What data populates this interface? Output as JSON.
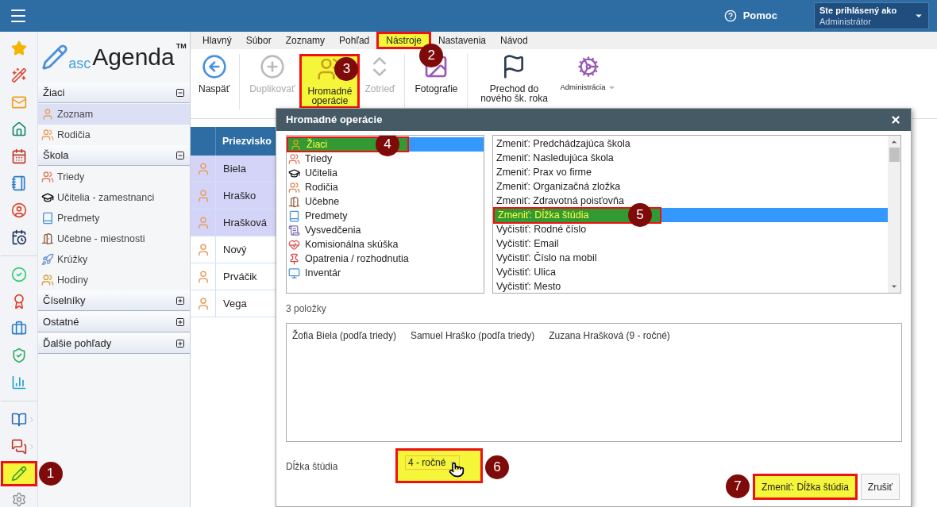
{
  "topbar": {
    "help": "Pomoc",
    "login_caption": "Ste prihlásený ako",
    "login_user": "Administrátor"
  },
  "rail": [
    {
      "selected": false,
      "submenu": false
    },
    {
      "selected": false,
      "submenu": false
    },
    {
      "selected": false,
      "submenu": false
    },
    {
      "selected": false,
      "submenu": false
    },
    {
      "selected": false,
      "submenu": false
    },
    {
      "selected": false,
      "submenu": false
    },
    {
      "selected": false,
      "submenu": false
    },
    {
      "selected": false,
      "submenu": false
    },
    {
      "selected": false,
      "submenu": false
    },
    {
      "selected": false,
      "submenu": false
    },
    {
      "selected": false,
      "submenu": false
    },
    {
      "selected": false,
      "submenu": false
    },
    {
      "selected": false,
      "submenu": false
    },
    {
      "selected": false,
      "submenu": true
    },
    {
      "selected": false,
      "submenu": true
    },
    {
      "selected": true,
      "submenu": false,
      "callout": "1"
    }
  ],
  "logo": {
    "prefix": "asc",
    "name": "Agenda",
    "tm": "TM"
  },
  "sidebar": [
    {
      "title": "Žiaci",
      "expanded": true,
      "items": [
        {
          "label": "Zoznam",
          "selected": true
        },
        {
          "label": "Rodičia",
          "selected": false
        }
      ]
    },
    {
      "title": "Škola",
      "expanded": true,
      "items": [
        {
          "label": "Triedy",
          "selected": false
        },
        {
          "label": "Učitelia - zamestnanci",
          "selected": false
        },
        {
          "label": "Predmety",
          "selected": false
        },
        {
          "label": "Učebne - miestnosti",
          "selected": false
        },
        {
          "label": "Krúžky",
          "selected": false
        },
        {
          "label": "Hodiny",
          "selected": false
        }
      ]
    },
    {
      "title": "Číselníky",
      "expanded": false
    },
    {
      "title": "Ostatné",
      "expanded": false
    },
    {
      "title": "Ďalšie pohľady",
      "expanded": false
    }
  ],
  "tabs": [
    {
      "label": "Hlavný",
      "selected": false
    },
    {
      "label": "Súbor",
      "selected": false
    },
    {
      "label": "Zoznamy",
      "selected": false
    },
    {
      "label": "Pohľad",
      "selected": false
    },
    {
      "label": "Nástroje",
      "selected": true,
      "callout": "2"
    },
    {
      "label": "Nastavenia",
      "selected": false
    },
    {
      "label": "Návod",
      "selected": false
    }
  ],
  "ribbon": [
    {
      "kind": "large",
      "label": "Naspäť",
      "disabled": false
    },
    {
      "kind": "large",
      "label": "Duplikovať",
      "disabled": true
    },
    {
      "kind": "large",
      "label": "Hromadné operácie",
      "disabled": false,
      "callout": "3"
    },
    {
      "kind": "large",
      "label": "Zotrieď",
      "disabled": true
    },
    {
      "kind": "large",
      "label": "Fotografie",
      "disabled": false
    },
    {
      "kind": "large",
      "label": "Prechod do nového šk. roka",
      "disabled": false
    },
    {
      "kind": "dropdown",
      "label": "Administrácia",
      "disabled": false
    }
  ],
  "table": {
    "columns": [
      "Priezvisko"
    ],
    "rows": [
      {
        "name": "Biela",
        "selected": true
      },
      {
        "name": "Hraško",
        "selected": true
      },
      {
        "name": "Hrašková",
        "selected": true
      },
      {
        "name": "Nový",
        "selected": false
      },
      {
        "name": "Prváčik",
        "selected": false
      },
      {
        "name": "Vega",
        "selected": false
      }
    ]
  },
  "dialog": {
    "title": "Hromadné operácie",
    "categories": [
      {
        "label": "Žiaci",
        "selected": true,
        "callout": "4"
      },
      {
        "label": "Triedy",
        "selected": false
      },
      {
        "label": "Učitelia",
        "selected": false
      },
      {
        "label": "Rodičia",
        "selected": false
      },
      {
        "label": "Učebne",
        "selected": false
      },
      {
        "label": "Predmety",
        "selected": false
      },
      {
        "label": "Vysvedčenia",
        "selected": false
      },
      {
        "label": "Komisionálna skúška",
        "selected": false
      },
      {
        "label": "Opatrenia / rozhodnutia",
        "selected": false
      },
      {
        "label": "Inventár",
        "selected": false
      }
    ],
    "operations": [
      {
        "label": "Zmeniť: Predchádzajúca škola",
        "selected": false
      },
      {
        "label": "Zmeniť: Nasledujúca škola",
        "selected": false
      },
      {
        "label": "Zmeniť: Prax vo firme",
        "selected": false
      },
      {
        "label": "Zmeniť: Organizačná zložka",
        "selected": false
      },
      {
        "label": "Zmeniť: Zdravotná poisťovňa",
        "selected": false
      },
      {
        "label": "Zmeniť: Dĺžka štúdia",
        "selected": true,
        "callout": "5"
      },
      {
        "label": "Vyčistiť: Rodné číslo",
        "selected": false
      },
      {
        "label": "Vyčistiť: Email",
        "selected": false
      },
      {
        "label": "Vyčistiť: Číslo na mobil",
        "selected": false
      },
      {
        "label": "Vyčistiť: Ulica",
        "selected": false
      },
      {
        "label": "Vyčistiť: Mesto",
        "selected": false
      }
    ],
    "count": "3 položky",
    "items": [
      "Žofia Biela (podľa triedy)",
      "Samuel Hraško (podľa triedy)",
      "Zuzana Hrašková (9 - ročné)"
    ],
    "field_label": "Dĺžka štúdia",
    "field_value": "4 - ročné",
    "field_callout": "6",
    "buttons": [
      {
        "kind": "primary",
        "label": "Zmeniť: Dĺžka štúdia",
        "callout": "7"
      },
      {
        "kind": "secondary",
        "label": "Zrušiť"
      }
    ]
  }
}
